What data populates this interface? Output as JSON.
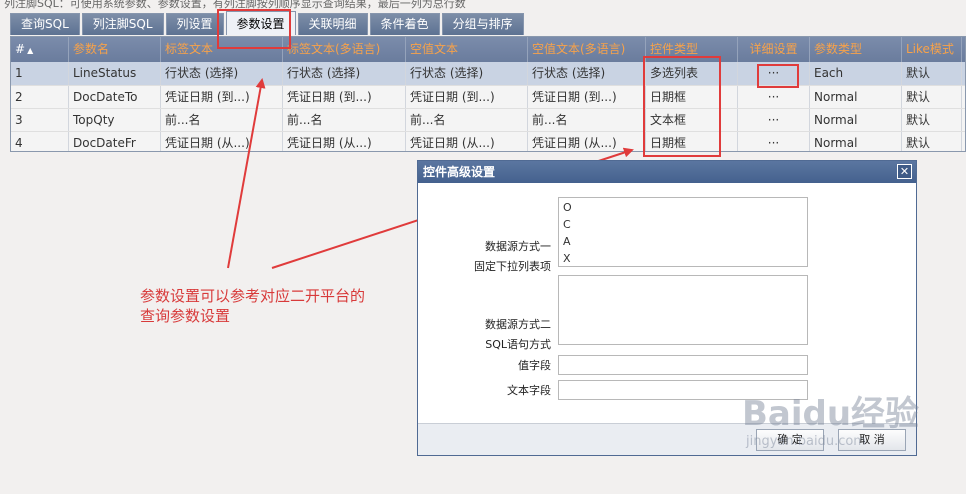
{
  "hint": "列注脚SQL：可使用系统参数、参数设置，有列注脚按列顺序显示查询结果，最后一列为总行数",
  "tabs": [
    {
      "label": "查询SQL",
      "active": false
    },
    {
      "label": "列注脚SQL",
      "active": false
    },
    {
      "label": "列设置",
      "active": false
    },
    {
      "label": "参数设置",
      "active": true
    },
    {
      "label": "关联明细",
      "active": false
    },
    {
      "label": "条件着色",
      "active": false
    },
    {
      "label": "分组与排序",
      "active": false
    }
  ],
  "grid": {
    "headers": [
      "#",
      "参数名",
      "标签文本",
      "标签文本(多语言)",
      "空值文本",
      "空值文本(多语言)",
      "控件类型",
      "详细设置",
      "参数类型",
      "Like模式"
    ],
    "rows": [
      [
        "1",
        "LineStatus",
        "行状态 (选择)",
        "行状态 (选择)",
        "行状态 (选择)",
        "行状态 (选择)",
        "多选列表",
        "···",
        "Each",
        "默认"
      ],
      [
        "2",
        "DocDateTo",
        "凭证日期 (到...)",
        "凭证日期 (到...)",
        "凭证日期 (到...)",
        "凭证日期 (到...)",
        "日期框",
        "···",
        "Normal",
        "默认"
      ],
      [
        "3",
        "TopQty",
        "前...名",
        "前...名",
        "前...名",
        "前...名",
        "文本框",
        "···",
        "Normal",
        "默认"
      ],
      [
        "4",
        "DocDateFr",
        "凭证日期 (从...)",
        "凭证日期 (从...)",
        "凭证日期 (从...)",
        "凭证日期 (从...)",
        "日期框",
        "···",
        "Normal",
        "默认"
      ]
    ]
  },
  "annotation": {
    "line1": "参数设置可以参考对应二开平台的",
    "line2": "查询参数设置"
  },
  "dialog": {
    "title": "控件高级设置",
    "close_glyph": "✕",
    "source1_label_a": "数据源方式一",
    "source1_label_b": "固定下拉列表项",
    "source1_items": [
      "O",
      "C",
      "A",
      "X"
    ],
    "source2_label_a": "数据源方式二",
    "source2_label_b": "SQL语句方式",
    "value_field_label": "值字段",
    "value_field_value": "",
    "text_field_label": "文本字段",
    "text_field_value": "",
    "ok_label": "确 定",
    "cancel_label": "取 消"
  },
  "watermark": {
    "big": "Baidu经验",
    "small": "jingyan.baidu.com"
  },
  "colors": {
    "annotation_red": "#e03b3b",
    "header_text": "#f7a24a",
    "dialog_title_bg": "#44618e"
  }
}
